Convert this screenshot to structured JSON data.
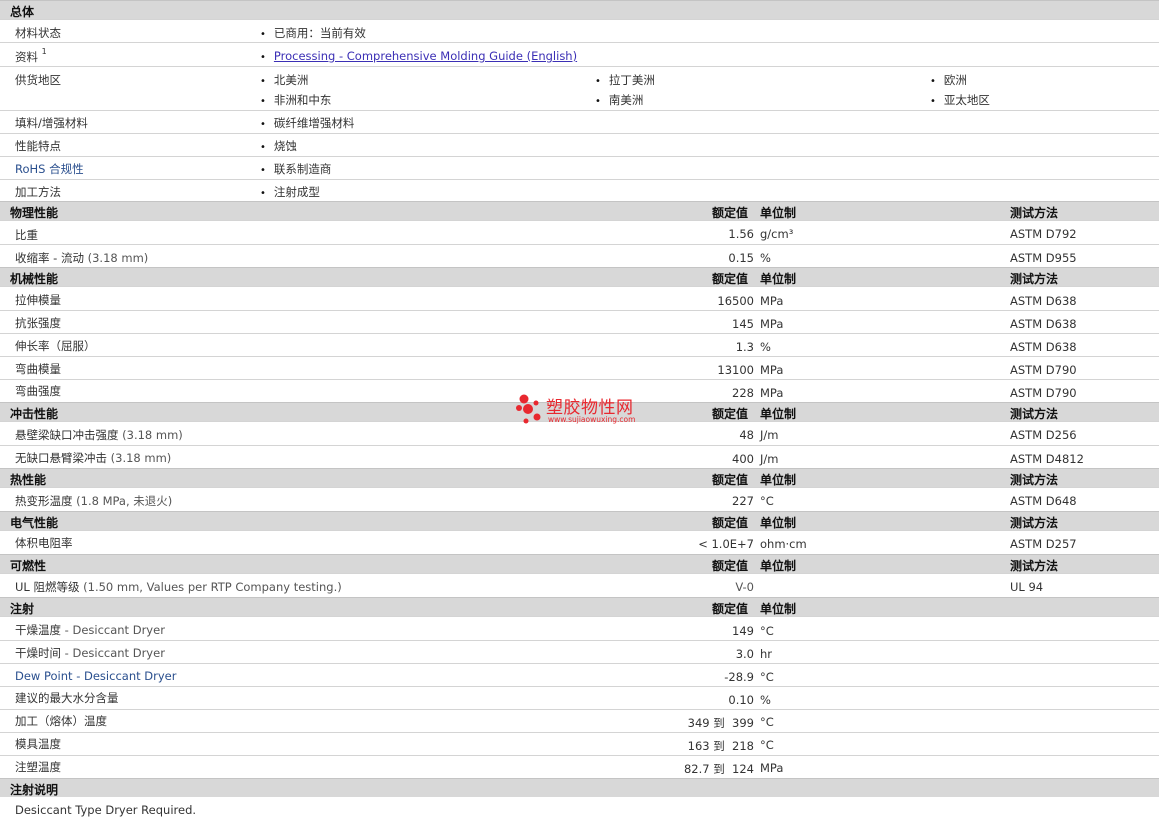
{
  "general": {
    "title": "总体",
    "material_status": {
      "label": "材料状态",
      "value": "已商用：当前有效"
    },
    "literature": {
      "label": "资料",
      "sup": "1",
      "link": "Processing - Comprehensive Molding Guide (English)"
    },
    "availability": {
      "label": "供货地区",
      "regions": [
        "北美洲",
        "拉丁美洲",
        "欧洲",
        "非洲和中东",
        "南美洲",
        "亚太地区"
      ]
    },
    "filler": {
      "label": "填料/增强材料",
      "value": "碳纤维增强材料"
    },
    "features": {
      "label": "性能特点",
      "value": "烧蚀"
    },
    "rohs": {
      "label": "RoHS 合规性",
      "value": "联系制造商"
    },
    "processing": {
      "label": "加工方法",
      "value": "注射成型"
    }
  },
  "headers": {
    "nominal": "额定值",
    "unit": "单位制",
    "method": "测试方法"
  },
  "physical": {
    "title": "物理性能",
    "rows": [
      {
        "label": "比重",
        "cond": "",
        "value": "1.56",
        "unit": "g/cm³",
        "method": "ASTM D792"
      },
      {
        "label": "收缩率 - 流动",
        "cond": "(3.18 mm)",
        "value": "0.15",
        "unit": "%",
        "method": "ASTM D955"
      }
    ]
  },
  "mechanical": {
    "title": "机械性能",
    "rows": [
      {
        "label": "拉伸模量",
        "cond": "",
        "value": "16500",
        "unit": "MPa",
        "method": "ASTM D638"
      },
      {
        "label": "抗张强度",
        "cond": "",
        "value": "145",
        "unit": "MPa",
        "method": "ASTM D638"
      },
      {
        "label": "伸长率（屈服）",
        "cond": "",
        "value": "1.3",
        "unit": "%",
        "method": "ASTM D638"
      },
      {
        "label": "弯曲模量",
        "cond": "",
        "value": "13100",
        "unit": "MPa",
        "method": "ASTM D790"
      },
      {
        "label": "弯曲强度",
        "cond": "",
        "value": "228",
        "unit": "MPa",
        "method": "ASTM D790"
      }
    ]
  },
  "impact": {
    "title": "冲击性能",
    "rows": [
      {
        "label": "悬壁梁缺口冲击强度",
        "cond": "(3.18 mm)",
        "value": "48",
        "unit": "J/m",
        "method": "ASTM D256"
      },
      {
        "label": "无缺口悬臂梁冲击",
        "cond": "(3.18 mm)",
        "value": "400",
        "unit": "J/m",
        "method": "ASTM D4812"
      }
    ]
  },
  "thermal": {
    "title": "热性能",
    "rows": [
      {
        "label": "热变形温度",
        "cond": "(1.8 MPa, 未退火)",
        "value": "227",
        "unit": "°C",
        "method": "ASTM D648"
      }
    ]
  },
  "electrical": {
    "title": "电气性能",
    "rows": [
      {
        "label": "体积电阻率",
        "cond": "",
        "value": "< 1.0E+7",
        "unit": "ohm·cm",
        "method": "ASTM D257"
      }
    ]
  },
  "flammability": {
    "title": "可燃性",
    "rows": [
      {
        "label": "UL 阻燃等级",
        "cond": "(1.50 mm, Values per RTP Company testing.)",
        "value": "V-0",
        "unit": "",
        "method": "UL 94"
      }
    ]
  },
  "injection": {
    "title": "注射",
    "rows": [
      {
        "label": "干燥温度",
        "cond": "- Desiccant Dryer",
        "value": "149",
        "unit": "°C"
      },
      {
        "label": "干燥时间",
        "cond": "- Desiccant Dryer",
        "value": "3.0",
        "unit": "hr"
      },
      {
        "label": "Dew Point - Desiccant Dryer",
        "cond": "",
        "value": "-28.9",
        "unit": "°C"
      },
      {
        "label": "建议的最大水分含量",
        "cond": "",
        "value": "0.10",
        "unit": "%"
      },
      {
        "label": "加工（熔体）温度",
        "cond": "",
        "value": "349 到  399",
        "unit": "°C"
      },
      {
        "label": "模具温度",
        "cond": "",
        "value": "163 到  218",
        "unit": "°C"
      },
      {
        "label": "注塑温度",
        "cond": "",
        "value": "82.7 到  124",
        "unit": "MPa"
      }
    ]
  },
  "notes": {
    "title": "注射说明",
    "text": "Desiccant Type Dryer Required."
  },
  "watermark": {
    "text": "塑胶物性网",
    "url": "www.sujiaowuxing.com",
    "color": "#e8282f"
  }
}
